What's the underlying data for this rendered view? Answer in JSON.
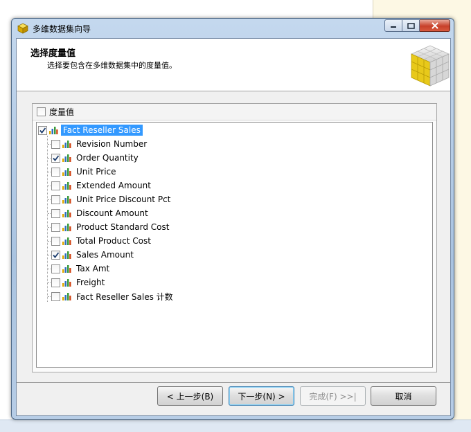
{
  "window": {
    "title": "多维数据集向导"
  },
  "header": {
    "title": "选择度量值",
    "subtitle": "选择要包含在多维数据集中的度量值。"
  },
  "measures": {
    "all_label": "度量值",
    "all_checked": false,
    "group": {
      "label": "Fact Reseller Sales",
      "checked": true,
      "selected": true
    },
    "items": [
      {
        "label": "Revision Number",
        "checked": false
      },
      {
        "label": "Order Quantity",
        "checked": true
      },
      {
        "label": "Unit Price",
        "checked": false
      },
      {
        "label": "Extended Amount",
        "checked": false
      },
      {
        "label": "Unit Price Discount Pct",
        "checked": false
      },
      {
        "label": "Discount Amount",
        "checked": false
      },
      {
        "label": "Product Standard Cost",
        "checked": false
      },
      {
        "label": "Total Product Cost",
        "checked": false
      },
      {
        "label": "Sales Amount",
        "checked": true
      },
      {
        "label": "Tax Amt",
        "checked": false
      },
      {
        "label": "Freight",
        "checked": false
      },
      {
        "label": "Fact Reseller Sales 计数",
        "checked": false
      }
    ]
  },
  "buttons": {
    "back": "< 上一步(B)",
    "next": "下一步(N) >",
    "finish": "完成(F) >>|",
    "cancel": "取消"
  },
  "icons": {
    "app": "cube-icon",
    "measure": "bar-chart-icon",
    "header": "cube-wizard-icon"
  },
  "colors": {
    "selection": "#3399ff",
    "cube_yellow": "#f2d21b"
  }
}
